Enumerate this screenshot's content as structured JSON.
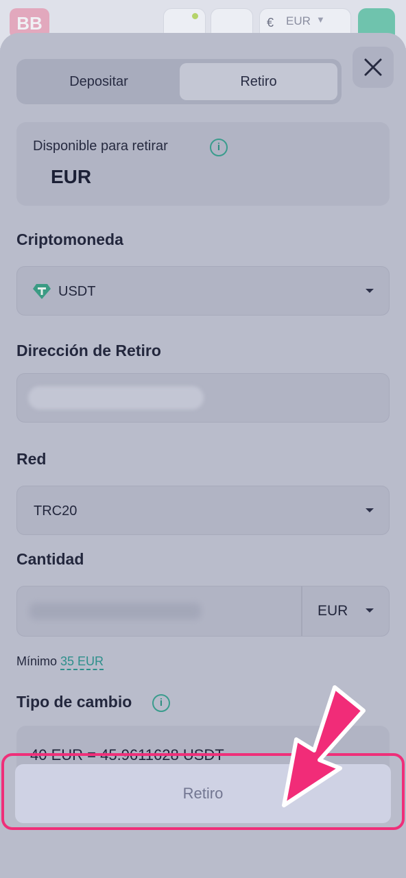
{
  "header": {
    "logo_text": "BB",
    "currency_symbol": "€",
    "currency_code": "EUR"
  },
  "tabs": [
    {
      "label": "Depositar",
      "active": false
    },
    {
      "label": "Retiro",
      "active": true
    }
  ],
  "available": {
    "label": "Disponible para retirar",
    "currency": "EUR"
  },
  "crypto": {
    "label": "Criptomoneda",
    "selected": "USDT"
  },
  "address": {
    "label": "Dirección de Retiro"
  },
  "network": {
    "label": "Red",
    "selected": "TRC20"
  },
  "amount": {
    "label": "Cantidad",
    "currency": "EUR",
    "minimum_label": "Mínimo",
    "minimum_value": "35 EUR"
  },
  "exchange": {
    "label": "Tipo de cambio",
    "value": "40 EUR = 45.9611628 USDT"
  },
  "submit_label": "Retiro",
  "colors": {
    "accent_teal": "#2d8f8b",
    "highlight_pink": "#ef2f79"
  }
}
